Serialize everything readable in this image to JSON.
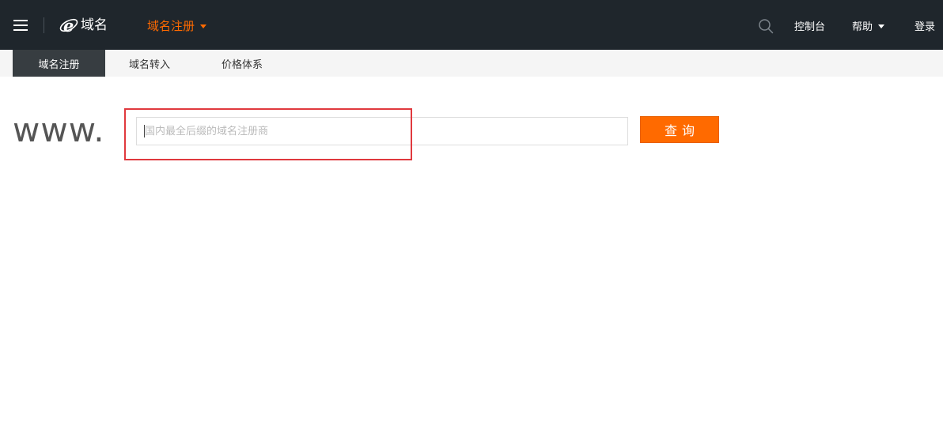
{
  "header": {
    "logo_text": "域名",
    "nav_active_label": "域名注册",
    "links": {
      "console": "控制台",
      "help": "帮助",
      "login": "登录"
    }
  },
  "subnav": {
    "tabs": [
      {
        "label": "域名注册",
        "active": true
      },
      {
        "label": "域名转入",
        "active": false
      },
      {
        "label": "价格体系",
        "active": false
      }
    ]
  },
  "search": {
    "prefix": "www.",
    "placeholder": "国内最全后缀的域名注册商",
    "value": "",
    "button_label": "查询"
  },
  "colors": {
    "topbar_bg": "#1f262c",
    "accent": "#ff6a00",
    "subnav_active_bg": "#373d41",
    "highlight_border": "#e0393e"
  },
  "icons": {
    "menu": "hamburger-menu-icon",
    "logo": "e-logo-icon",
    "search": "search-icon",
    "dropdown": "caret-down-icon"
  }
}
